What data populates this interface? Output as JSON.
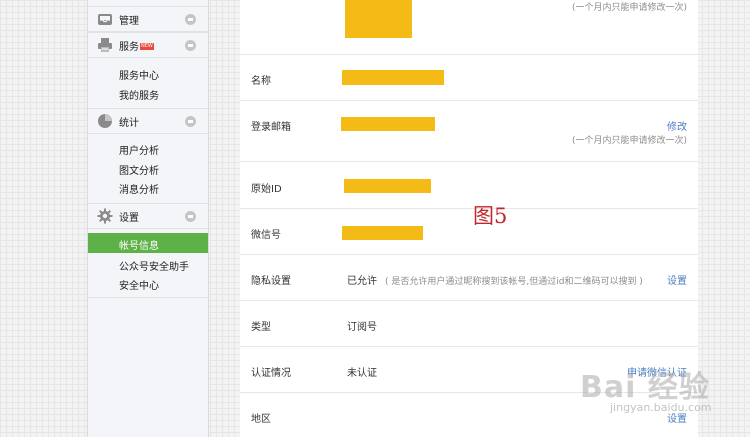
{
  "sidebar": {
    "manage": {
      "label": "管理",
      "icon": "inbox-icon"
    },
    "service": {
      "label": "服务",
      "badge": "NEW",
      "icon": "printer-icon",
      "items": [
        {
          "label": "服务中心"
        },
        {
          "label": "我的服务"
        }
      ]
    },
    "stats": {
      "label": "统计",
      "icon": "pie-chart-icon",
      "items": [
        {
          "label": "用户分析"
        },
        {
          "label": "图文分析"
        },
        {
          "label": "消息分析"
        }
      ]
    },
    "settings": {
      "label": "设置",
      "icon": "gear-icon",
      "items": [
        {
          "label": "帐号信息",
          "active": true
        },
        {
          "label": "公众号安全助手"
        },
        {
          "label": "安全中心"
        }
      ]
    },
    "colors": {
      "active_bg": "#5eb147"
    }
  },
  "main": {
    "avatar_note": "(一个月内只能申请修改一次)",
    "rows": {
      "name": {
        "label": "名称"
      },
      "email": {
        "label": "登录邮箱",
        "action": "修改",
        "note": "(一个月内只能申请修改一次)"
      },
      "original_id": {
        "label": "原始ID"
      },
      "wechat_id": {
        "label": "微信号"
      },
      "privacy": {
        "label": "隐私设置",
        "value": "已允许",
        "hint": "( 是否允许用户通过昵称搜到该帐号,但通过id和二维码可以搜到 )",
        "action": "设置"
      },
      "type": {
        "label": "类型",
        "value": "订阅号"
      },
      "verify": {
        "label": "认证情况",
        "value": "未认证",
        "action": "申请微信认证"
      },
      "region": {
        "label": "地区",
        "action": "设置"
      }
    },
    "redaction_color": "#f4bb16"
  },
  "annotation": {
    "figure_label": "图5"
  },
  "watermark": {
    "text": "Bai 经验",
    "sub": "jingyan.baidu.com"
  }
}
